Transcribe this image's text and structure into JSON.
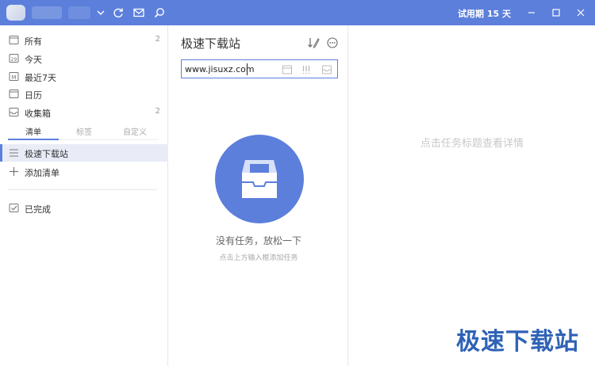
{
  "titlebar": {
    "trial_text": "试用期 15 天",
    "icons": [
      "chevron-down-icon",
      "sync-icon",
      "mail-icon",
      "search-icon"
    ],
    "window_buttons": [
      "minimize-icon",
      "maximize-icon",
      "close-icon"
    ]
  },
  "sidebar": {
    "smart_lists": [
      {
        "label": "所有",
        "count": "2",
        "icon": "calendar-all-icon"
      },
      {
        "label": "今天",
        "count": "",
        "icon": "calendar-today-icon",
        "icon_text": "29"
      },
      {
        "label": "最近7天",
        "count": "",
        "icon": "calendar-week-icon",
        "icon_text": "M"
      },
      {
        "label": "日历",
        "count": "",
        "icon": "calendar-icon"
      },
      {
        "label": "收集箱",
        "count": "2",
        "icon": "inbox-icon"
      }
    ],
    "tabs": [
      "清单",
      "标签",
      "自定义"
    ],
    "active_tab": "清单",
    "lists": [
      {
        "label": "极速下载站",
        "icon": "list-icon"
      }
    ],
    "add_list_label": "添加清单",
    "completed_label": "已完成"
  },
  "middle": {
    "title": "极速下载站",
    "task_input_value": "www.jisuxz.com",
    "empty_title": "没有任务，放松一下",
    "empty_subtitle": "点击上方输入框添加任务"
  },
  "right": {
    "hint": "点击任务标题查看详情"
  },
  "watermark": "极速下载站",
  "colors": {
    "accent": "#5c7fdb",
    "titlebar": "#5c7fdb",
    "selected_bg": "#e9ecf7",
    "watermark": "#2f62b6"
  }
}
